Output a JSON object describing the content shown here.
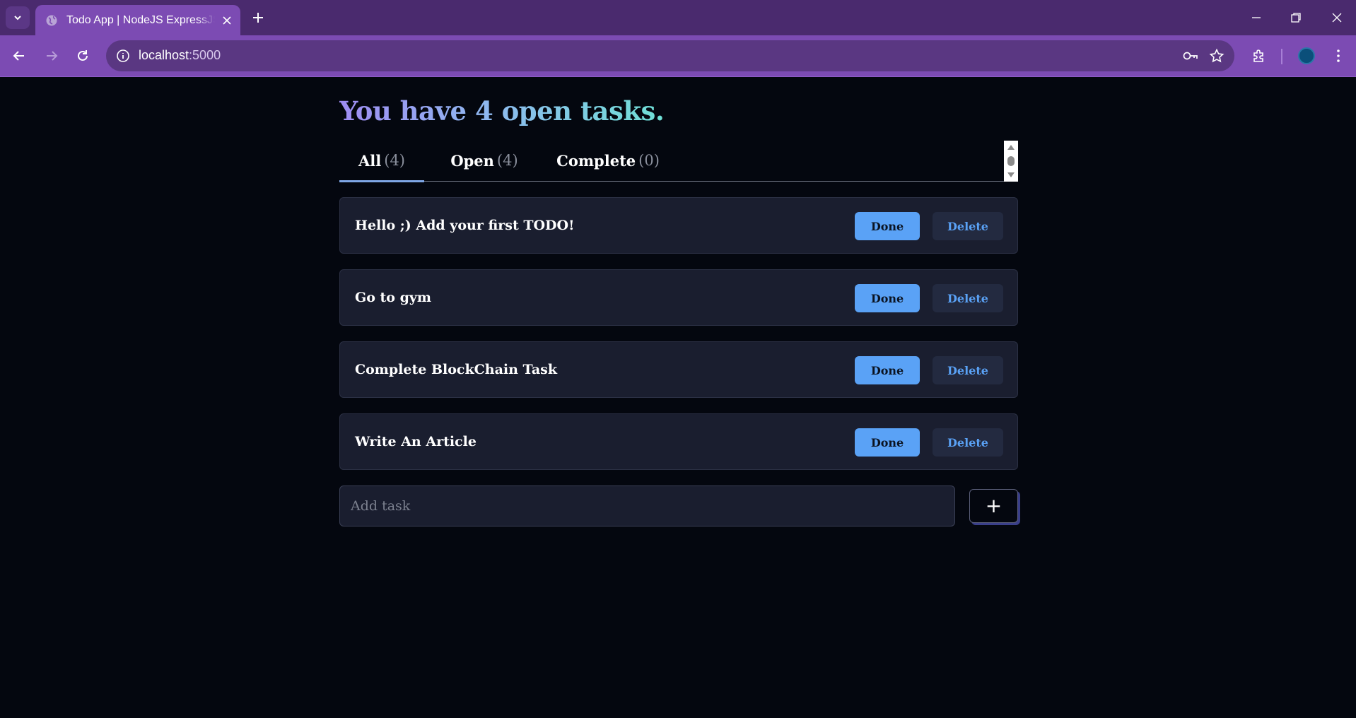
{
  "browser": {
    "tab_title": "Todo App | NodeJS ExpressJS S",
    "url_host": "localhost",
    "url_port": ":5000",
    "theme_color": "#7c4bb3"
  },
  "page": {
    "heading": "You have 4 open tasks.",
    "filters": [
      {
        "label": "All",
        "count": "(4)",
        "active": true
      },
      {
        "label": "Open",
        "count": "(4)",
        "active": false
      },
      {
        "label": "Complete",
        "count": "(0)",
        "active": false
      }
    ],
    "tasks": [
      {
        "text": "Hello ;) Add your first TODO!"
      },
      {
        "text": "Go to gym"
      },
      {
        "text": "Complete BlockChain Task"
      },
      {
        "text": "Write An Article"
      }
    ],
    "done_label": "Done",
    "delete_label": "Delete",
    "add_placeholder": "Add task",
    "add_button_label": "+",
    "accent_color": "#5aa2f6"
  }
}
